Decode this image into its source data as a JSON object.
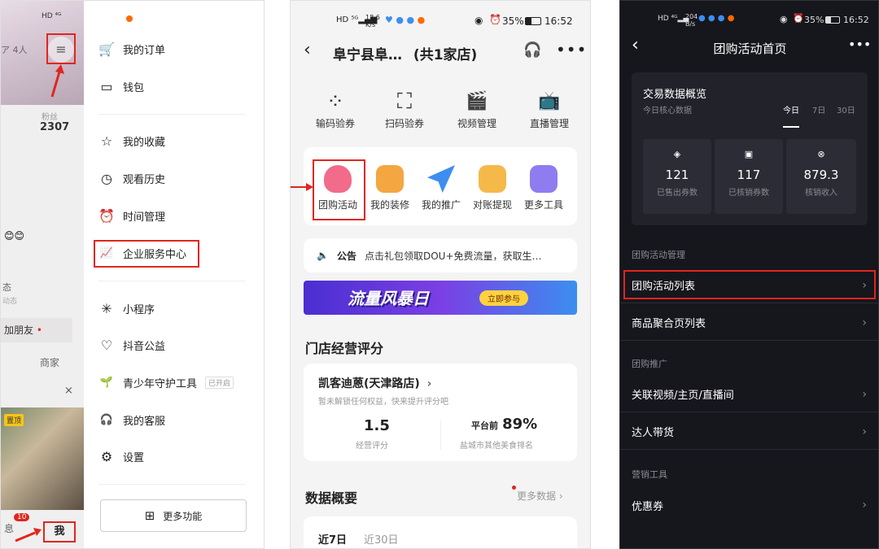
{
  "phone1": {
    "status_icons": "HD ⁴ᴳ",
    "tab_fragment": "ア 4人",
    "fans_label": "粉丝",
    "fans_value": "2307",
    "emoji": "😊😊",
    "frag_dongtai_1": "态",
    "frag_dongtai_2": "动态",
    "add_friend": "加朋友",
    "merchant": "商家",
    "pinned": "置顶",
    "close": "×",
    "msg_badge": "10",
    "msg_label": "息",
    "me_label": "我",
    "menu": [
      {
        "icon": "cart-icon",
        "glyph": "🛒",
        "label": "我的订单"
      },
      {
        "icon": "wallet-icon",
        "glyph": "▭",
        "label": "钱包"
      },
      {
        "icon": "star-icon",
        "glyph": "☆",
        "label": "我的收藏"
      },
      {
        "icon": "clock-icon",
        "glyph": "◷",
        "label": "观看历史"
      },
      {
        "icon": "alarm-icon",
        "glyph": "⏰",
        "label": "时间管理"
      },
      {
        "icon": "chart-icon",
        "glyph": "📈",
        "label": "企业服务中心"
      },
      {
        "icon": "mini-program-icon",
        "glyph": "✳",
        "label": "小程序"
      },
      {
        "icon": "charity-icon",
        "glyph": "♡",
        "label": "抖音公益"
      },
      {
        "icon": "sprout-icon",
        "glyph": "🌱",
        "label": "青少年守护工具"
      },
      {
        "icon": "headset-icon",
        "glyph": "🎧",
        "label": "我的客服"
      },
      {
        "icon": "gear-icon",
        "glyph": "⚙",
        "label": "设置"
      }
    ],
    "youth_badge": "已开启",
    "more_button": "更多功能"
  },
  "phone2": {
    "status_speed": "18.6 K/s",
    "status_battery": "35%",
    "status_time": "16:52",
    "title": "阜宁县阜…",
    "title_count": "(共1家店)",
    "tools_row1": [
      {
        "icon": "code-verify-icon",
        "glyph": "⁘",
        "label": "输码验券"
      },
      {
        "icon": "scan-icon",
        "glyph": "⛶",
        "label": "扫码验券"
      },
      {
        "icon": "video-icon",
        "glyph": "🎬",
        "label": "视频管理"
      },
      {
        "icon": "live-icon",
        "glyph": "📺",
        "label": "直播管理"
      }
    ],
    "tools_row2": [
      {
        "icon": "group-buy-icon",
        "label": "团购活动",
        "color": "#f26b8a"
      },
      {
        "icon": "decor-icon",
        "label": "我的装修",
        "color": "#f4a640"
      },
      {
        "icon": "promote-icon",
        "label": "我的推广",
        "color": "#3d8ef0"
      },
      {
        "icon": "withdraw-icon",
        "label": "对账提现",
        "color": "#f5b94a"
      },
      {
        "icon": "more-tools-icon",
        "label": "更多工具",
        "color": "#8f7cf0"
      }
    ],
    "notice_label": "公告",
    "notice_text": "点击礼包领取DOU+免费流量，获取生…",
    "banner_text": "流量风暴日",
    "banner_button": "立即参与",
    "section_score": "门店经营评分",
    "store_name": "凯客迪蒽(天津路店)",
    "store_tip": "暂未解锁任何权益，快来提升评分吧",
    "score_value": "1.5",
    "score_label": "经营评分",
    "rank_prefix": "平台前",
    "rank_value": "89%",
    "rank_label": "盐城市其他美食排名",
    "section_data": "数据概要",
    "more_data": "更多数据",
    "tab_7": "近7日",
    "tab_30": "近30日"
  },
  "phone3": {
    "status_speed": "204 B/s",
    "status_battery": "35%",
    "status_time": "16:52",
    "title": "团购活动首页",
    "overview_title": "交易数据概览",
    "overview_sub": "今日核心数据",
    "tabs": [
      "今日",
      "7日",
      "30日"
    ],
    "stats": [
      {
        "icon": "sold-icon",
        "value": "121",
        "label": "已售出券数"
      },
      {
        "icon": "verified-icon",
        "value": "117",
        "label": "已核销券数"
      },
      {
        "icon": "income-icon",
        "value": "879.3",
        "label": "核销收入"
      }
    ],
    "section1": "团购活动管理",
    "row_list": "团购活动列表",
    "row_goods": "商品聚合页列表",
    "section2": "团购推广",
    "row_link": "关联视频/主页/直播间",
    "row_talent": "达人带货",
    "section3": "营销工具",
    "row_coupon": "优惠券"
  }
}
